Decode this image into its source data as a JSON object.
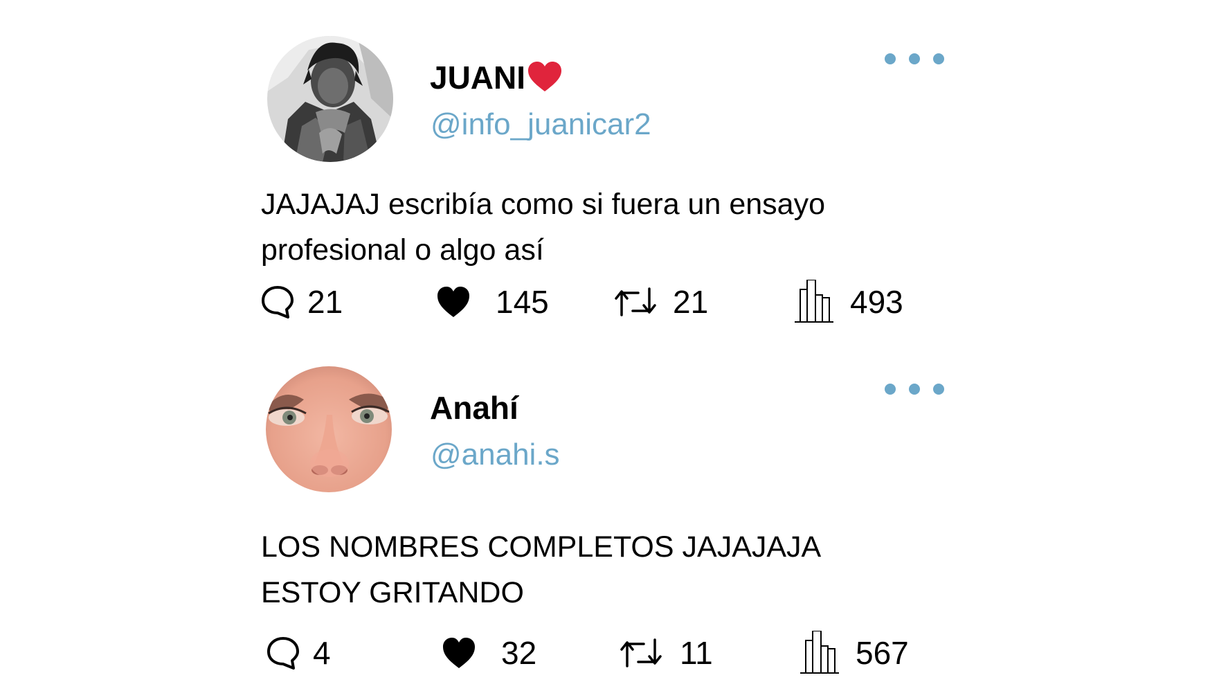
{
  "tweets": [
    {
      "author": {
        "display_name": "JUANI",
        "name_emoji": "red-heart-emoji",
        "handle": "@info_juanicar2",
        "avatar": "grayscale-photo-avatar"
      },
      "text_lines": [
        "JAJAJAJ escribía como si fuera un ensayo",
        "profesional o algo así"
      ],
      "stats": {
        "replies": "21",
        "likes": "145",
        "retweets": "21",
        "views": "493"
      }
    },
    {
      "author": {
        "display_name": "Anahí",
        "handle": "@anahi.s",
        "avatar": "closeup-face-avatar"
      },
      "text_lines": [
        "LOS NOMBRES COMPLETOS JAJAJAJA",
        "ESTOY GRITANDO"
      ],
      "stats": {
        "replies": "4",
        "likes": "32",
        "retweets": "11",
        "views": "567"
      }
    }
  ],
  "icons": {
    "reply": "speech-bubble-icon",
    "like": "heart-icon",
    "retweet": "retweet-arrows-icon",
    "views": "bar-chart-icon",
    "more": "more-dots-icon"
  },
  "colors": {
    "accent": "#6ba7c9",
    "heart": "#e0243c",
    "text": "#000000",
    "background": "#ffffff"
  }
}
